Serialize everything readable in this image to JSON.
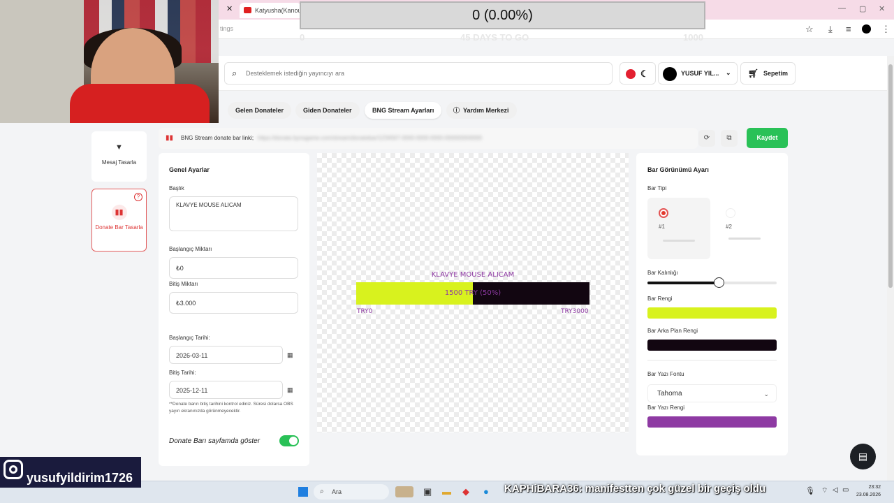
{
  "browser": {
    "tab_title": "Katyusha(Kanouai",
    "address_fragment": "tings"
  },
  "overlay": {
    "goal_value": "0 (0.00%)",
    "goal_left": "0",
    "goal_days": "45 DAYS TO GO",
    "goal_right": "1000"
  },
  "header": {
    "search_placeholder": "Desteklemek istediğin yayıncıyı ara",
    "user_name": "YUSUF YIL...",
    "cart_label": "Sepetim"
  },
  "subnav": {
    "items": [
      "Gelen Donateler",
      "Giden Donateler",
      "BNG Stream Ayarları",
      "Yardım Merkezi"
    ]
  },
  "sidenav": {
    "items": [
      {
        "label": "Mesaj Tasarla"
      },
      {
        "label": "Donate Bar Tasarla"
      }
    ]
  },
  "link_row": {
    "label": "BNG Stream donate bar linki;",
    "url": "https://donate.bynogame.com/stream/donatebar/1234567-0000-0000-0000-000000000000"
  },
  "save_label": "Kaydet",
  "general": {
    "title": "Genel Ayarlar",
    "title_label": "Başlık",
    "title_value": "KLAVYE MOUSE ALICAM",
    "start_label": "Başlangıç Miktarı",
    "start_value": "₺0",
    "end_label": "Bitiş Miktarı",
    "end_value": "₺3.000",
    "start_date_label": "Başlangıç Tarihi:",
    "start_date": "2026-03-11",
    "end_date_label": "Bitiş Tarihi:",
    "end_date": "2025-12-11",
    "note": "**Donate barın bitiş tarihini kontrol ediniz. Süresi dolarsa OBS yayın ekranınızda görünmeyecektir.",
    "show_label": "Donate Barı sayfamda göster",
    "show_on": true
  },
  "preview": {
    "title": "KLAVYE MOUSE ALICAM",
    "bar_text": "1500 TRY (50%)",
    "progress": 0.5,
    "min_label": "TRY0",
    "max_label": "TRY3000"
  },
  "appearance": {
    "title": "Bar Görünümü Ayarı",
    "type_label": "Bar Tipi",
    "type1": "#1",
    "type2": "#2",
    "thickness_label": "Bar Kalınlığı",
    "thickness_fraction": 0.55,
    "bar_color_label": "Bar Rengi",
    "bar_color": "#d8f21e",
    "bg_color_label": "Bar Arka Plan Rengi",
    "bg_color": "#120611",
    "font_label": "Bar Yazı Fontu",
    "font_value": "Tahoma",
    "text_color_label": "Bar Yazı Rengi",
    "text_color": "#8e3aa3"
  },
  "instagram_handle": "yusufyildirim1726",
  "taskbar": {
    "search": "Ara",
    "ticker": "KAPHiBARA36: manifestten çok güzel bir geçiş oldu",
    "time": "23:32",
    "date": "23.08.2026"
  }
}
